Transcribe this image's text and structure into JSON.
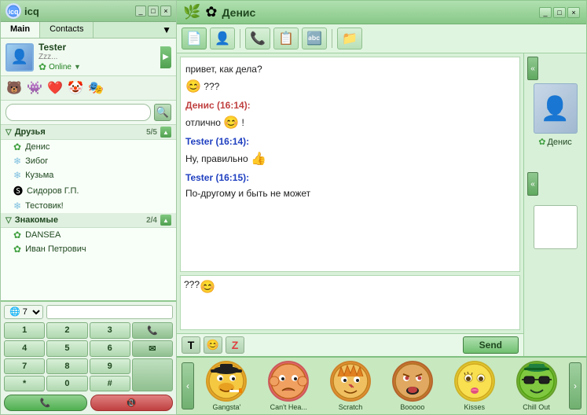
{
  "app": {
    "title": "icq",
    "left_tab_main": "Main",
    "left_tab_contacts": "Contacts"
  },
  "my_profile": {
    "name": "Tester",
    "status_text": "Zzz...",
    "status": "Online"
  },
  "contacts": {
    "group1_name": "Друзья",
    "group1_count": "5/5",
    "group2_name": "Знакомые",
    "group2_count": "2/4",
    "friends": [
      {
        "name": "Денис",
        "icon": "flower"
      },
      {
        "name": "Зибог",
        "icon": "snowflake"
      },
      {
        "name": "Кузьма",
        "icon": "snowflake"
      },
      {
        "name": "Сидоров Г.П.",
        "icon": "custom"
      },
      {
        "name": "Тестовик!",
        "icon": "snowflake"
      }
    ],
    "acquaintances": [
      {
        "name": "DANSEA",
        "icon": "flower"
      },
      {
        "name": "Иван Петрович",
        "icon": "flower"
      }
    ]
  },
  "dialer": {
    "country": "7",
    "buttons": [
      "1",
      "2",
      "3",
      "",
      "4",
      "5",
      "6",
      "",
      "7",
      "8",
      "9",
      "",
      "*",
      "0",
      "#",
      ""
    ]
  },
  "chat": {
    "title": "Денис",
    "messages": [
      {
        "type": "incoming",
        "text": "привет, как дела?"
      },
      {
        "type": "emoji",
        "text": "???"
      },
      {
        "type": "sender",
        "name": "Денис (16:14):",
        "color": "red",
        "text": "отлично"
      },
      {
        "type": "emoji_inline",
        "text": "!"
      },
      {
        "type": "sender",
        "name": "Tester (16:14):",
        "color": "blue",
        "text": "Ну, правильно"
      },
      {
        "type": "sender",
        "name": "Tester (16:15):",
        "color": "blue",
        "text": "По-другому и быть не может"
      }
    ],
    "input_text": "??? ",
    "send_button": "Send",
    "format_bold": "T",
    "format_emoji": "☺",
    "format_z": "Z"
  },
  "side_profile": {
    "name": "Денис"
  },
  "emoticons": [
    {
      "label": "Gangsta'",
      "face": "🤠"
    },
    {
      "label": "Can't Hea...",
      "face": "😤"
    },
    {
      "label": "Scratch",
      "face": "😾"
    },
    {
      "label": "Booooo",
      "face": "😡"
    },
    {
      "label": "Kisses",
      "face": "😚"
    },
    {
      "label": "Chill Out",
      "face": "😎"
    }
  ],
  "toolbar_buttons": [
    {
      "icon": "📄",
      "title": "New"
    },
    {
      "icon": "👤",
      "title": "Profile"
    },
    {
      "icon": "📞",
      "title": "Call"
    },
    {
      "icon": "📋",
      "title": "History"
    },
    {
      "icon": "🔤",
      "title": "Font"
    },
    {
      "icon": "📁",
      "title": "File"
    }
  ]
}
